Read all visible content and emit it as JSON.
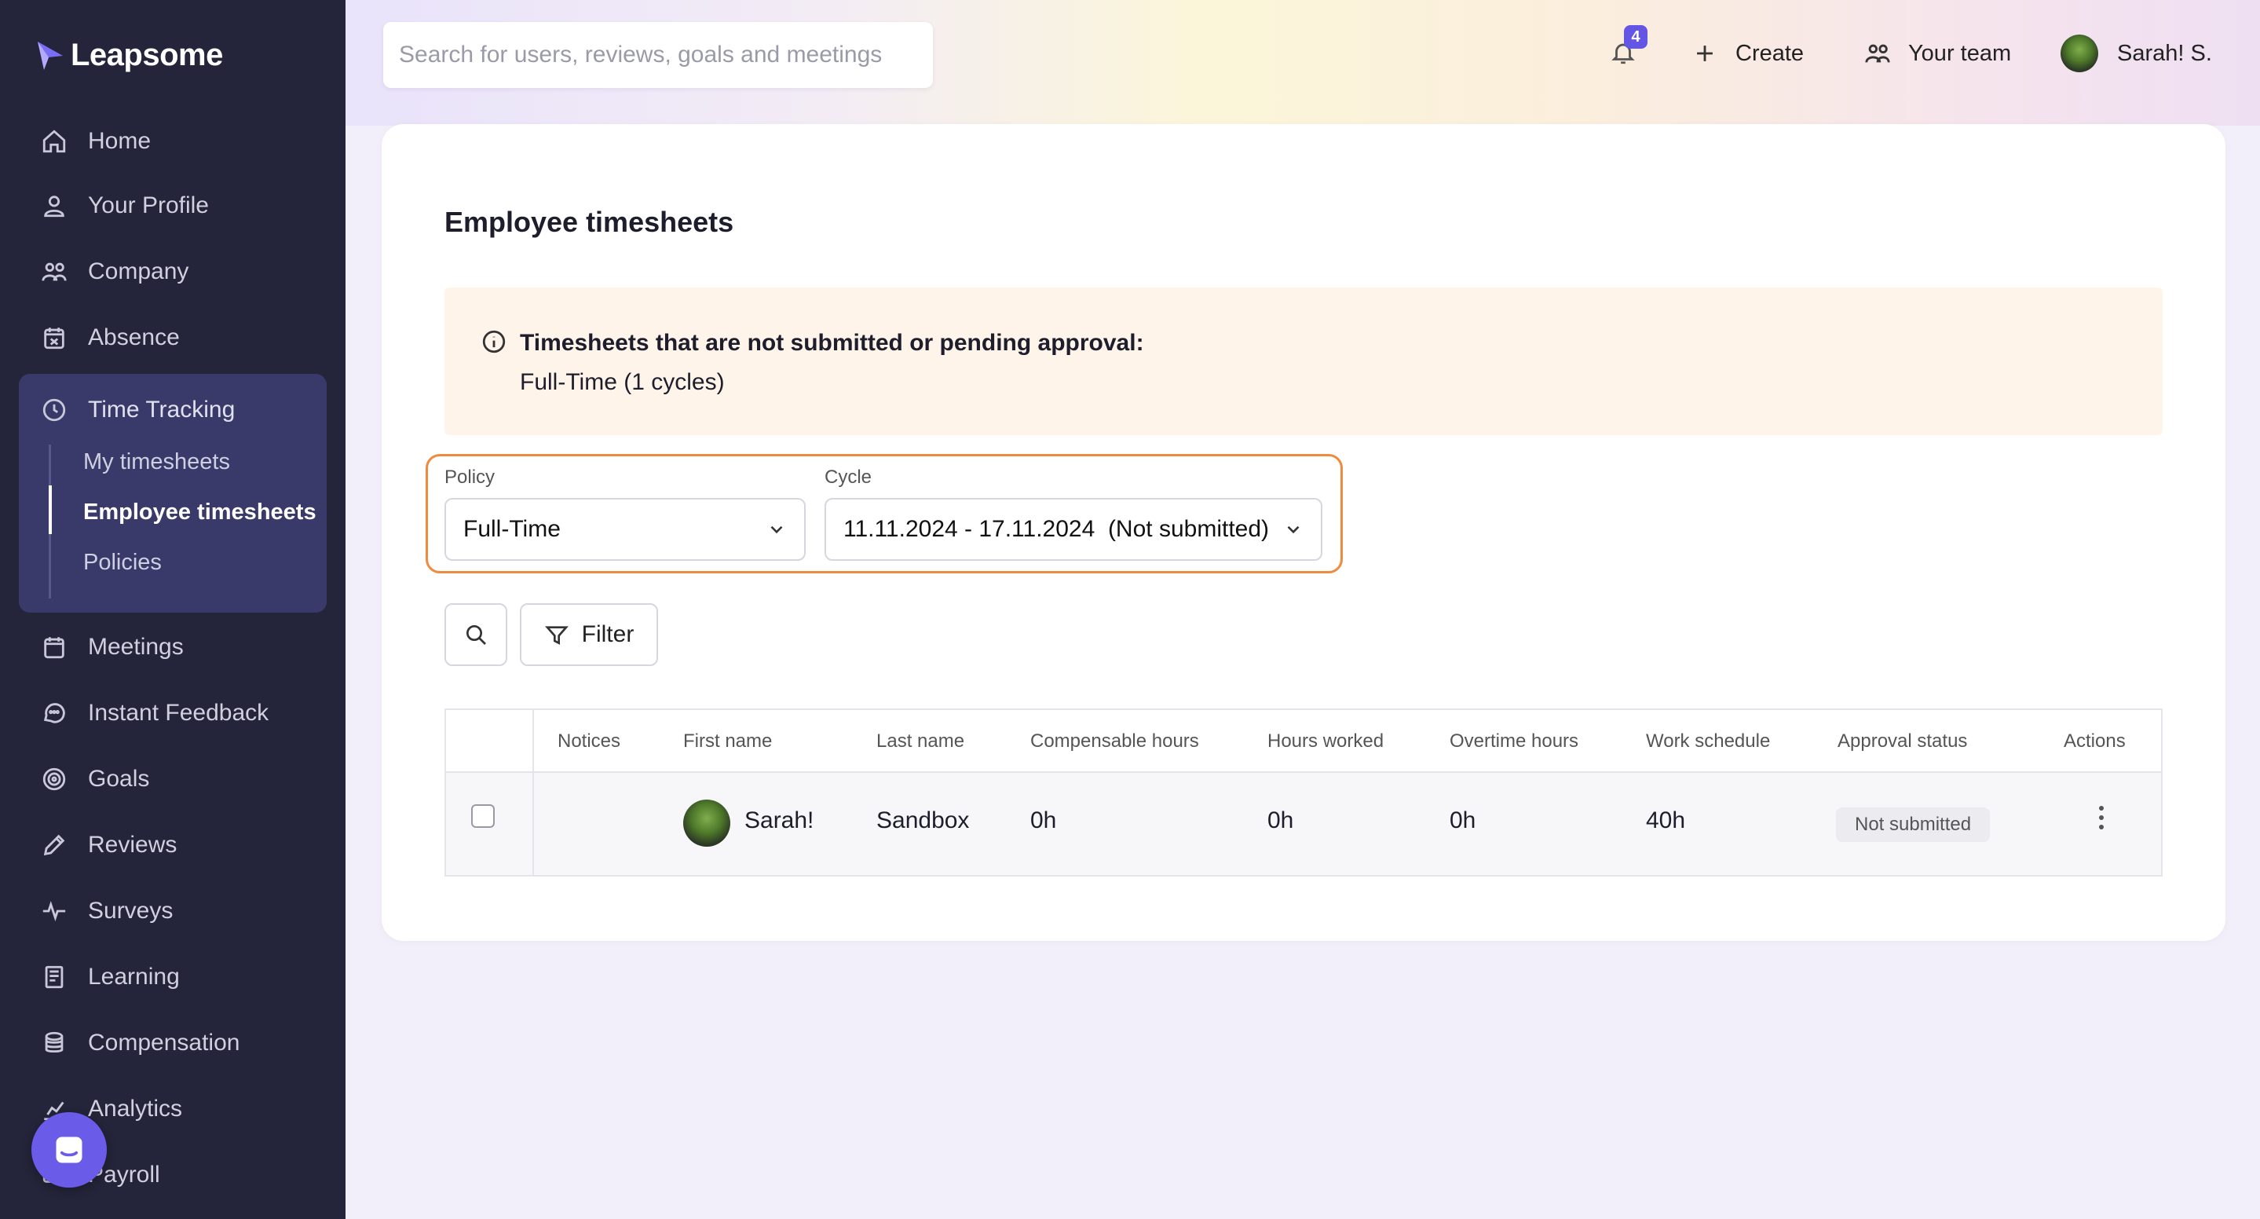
{
  "app": {
    "brand": "Leapsome",
    "accent": "#6356e5",
    "highlight": "#f08a3e"
  },
  "sidebar": {
    "items": [
      {
        "label": "Home",
        "icon": "home-icon"
      },
      {
        "label": "Your Profile",
        "icon": "user-icon"
      },
      {
        "label": "Company",
        "icon": "people-icon"
      },
      {
        "label": "Absence",
        "icon": "calendar-x-icon"
      },
      {
        "label": "Time Tracking",
        "icon": "clock-icon"
      },
      {
        "label": "Meetings",
        "icon": "calendar-icon"
      },
      {
        "label": "Instant Feedback",
        "icon": "chat-icon"
      },
      {
        "label": "Goals",
        "icon": "target-icon"
      },
      {
        "label": "Reviews",
        "icon": "pencil-icon"
      },
      {
        "label": "Surveys",
        "icon": "pulse-icon"
      },
      {
        "label": "Learning",
        "icon": "book-icon"
      },
      {
        "label": "Compensation",
        "icon": "coins-icon"
      },
      {
        "label": "Analytics",
        "icon": "chart-icon"
      },
      {
        "label": "Payroll",
        "icon": "payroll-icon"
      }
    ],
    "time_tracking_sub": [
      {
        "label": "My timesheets",
        "active": false
      },
      {
        "label": "Employee timesheets",
        "active": true
      },
      {
        "label": "Policies",
        "active": false
      }
    ]
  },
  "header": {
    "search_placeholder": "Search for users, reviews, goals and meetings",
    "notification_count": "4",
    "create_label": "Create",
    "team_label": "Your team",
    "user_name": "Sarah! S."
  },
  "main": {
    "title": "Employee timesheets",
    "notice": {
      "title": "Timesheets that are not submitted or pending approval:",
      "body": "Full-Time (1 cycles)"
    },
    "policy": {
      "label": "Policy",
      "value": "Full-Time"
    },
    "cycle": {
      "label": "Cycle",
      "value": "11.11.2024 - 17.11.2024  (Not submitted)"
    },
    "filter_label": "Filter",
    "table": {
      "headers": [
        "Notices",
        "First name",
        "Last name",
        "Compensable hours",
        "Hours worked",
        "Overtime hours",
        "Work schedule",
        "Approval status",
        "Actions"
      ],
      "rows": [
        {
          "notices": "",
          "first_name": "Sarah!",
          "last_name": "Sandbox",
          "compensable_hours": "0h",
          "hours_worked": "0h",
          "overtime_hours": "0h",
          "work_schedule": "40h",
          "approval_status": "Not submitted"
        }
      ]
    }
  }
}
